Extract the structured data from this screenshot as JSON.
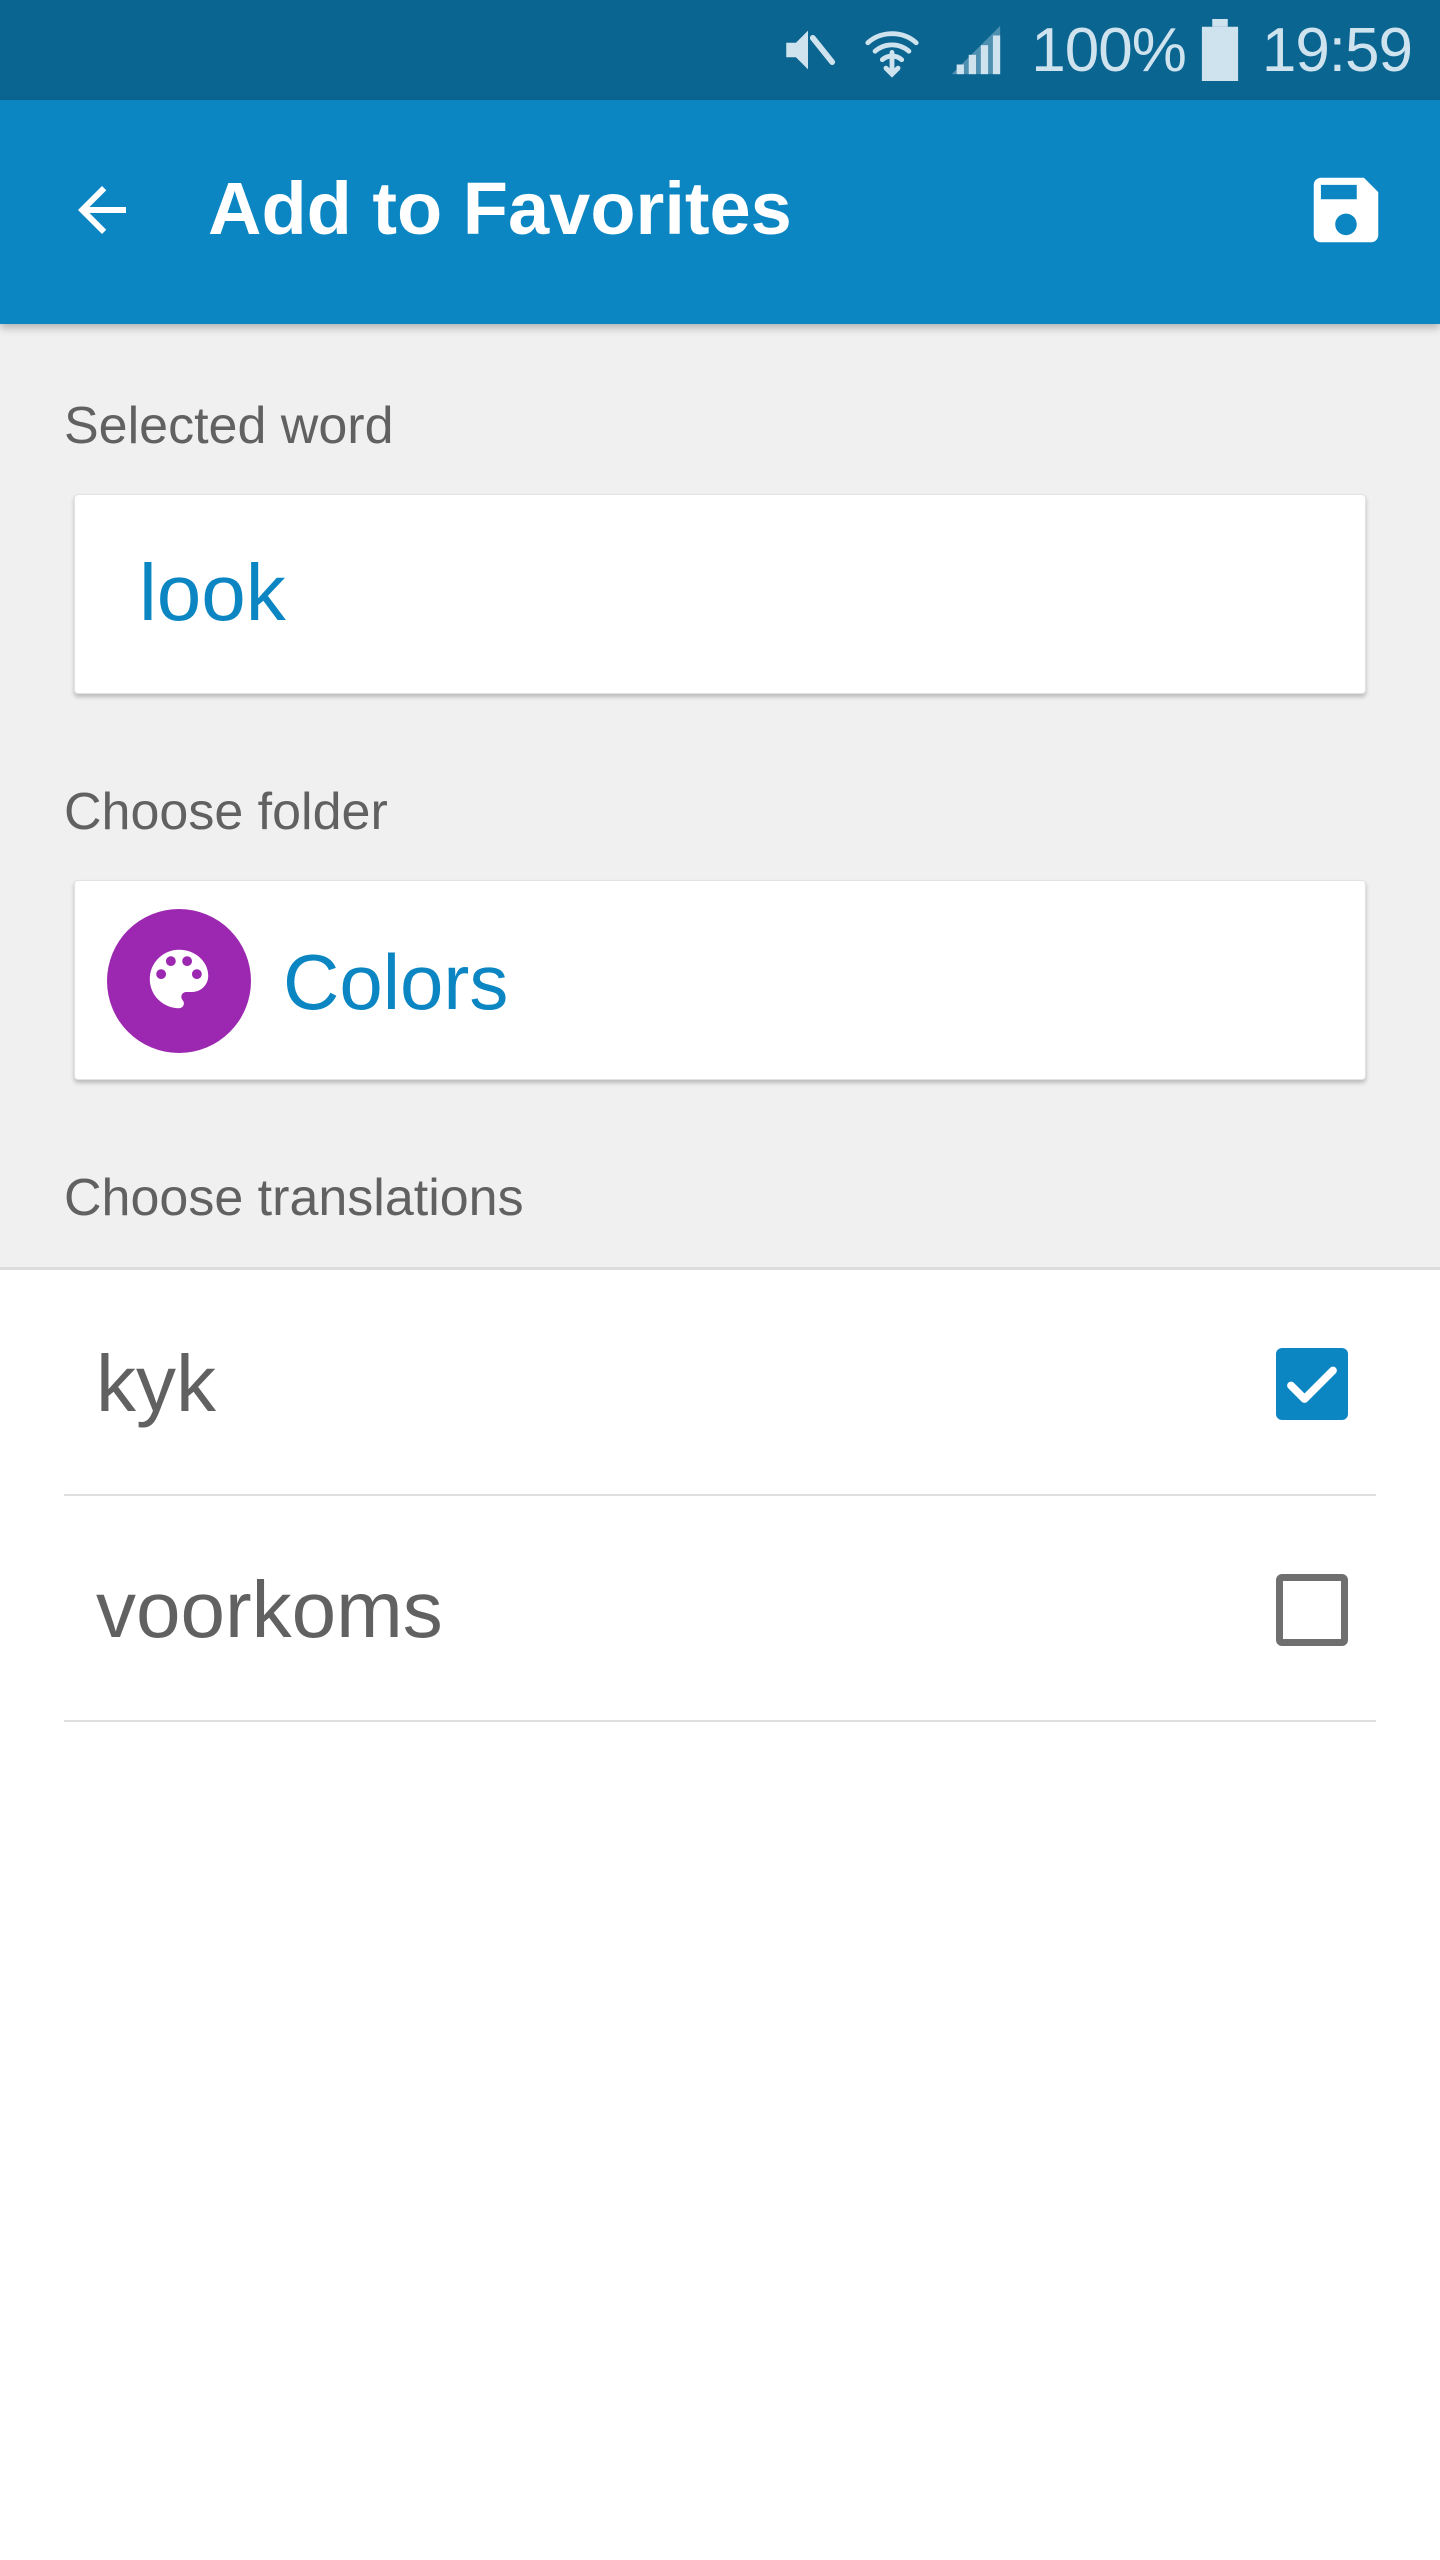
{
  "status_bar": {
    "battery_percent": "100%",
    "time": "19:59",
    "icons": [
      "mute-icon",
      "wifi-icon",
      "signal-icon",
      "battery-icon"
    ]
  },
  "app_bar": {
    "title": "Add to Favorites",
    "back_icon": "arrow-back-icon",
    "save_icon": "save-floppy-icon",
    "color": "#0b86c2"
  },
  "form": {
    "selected_word_label": "Selected word",
    "selected_word_value": "look",
    "choose_folder_label": "Choose folder",
    "folder": {
      "name": "Colors",
      "icon": "palette-icon",
      "icon_color": "#9c27b0"
    },
    "choose_translations_label": "Choose translations"
  },
  "translations": [
    {
      "text": "kyk",
      "checked": true
    },
    {
      "text": "voorkoms",
      "checked": false
    }
  ],
  "colors": {
    "accent": "#0b86c2",
    "status_bar": "#0b6591"
  }
}
